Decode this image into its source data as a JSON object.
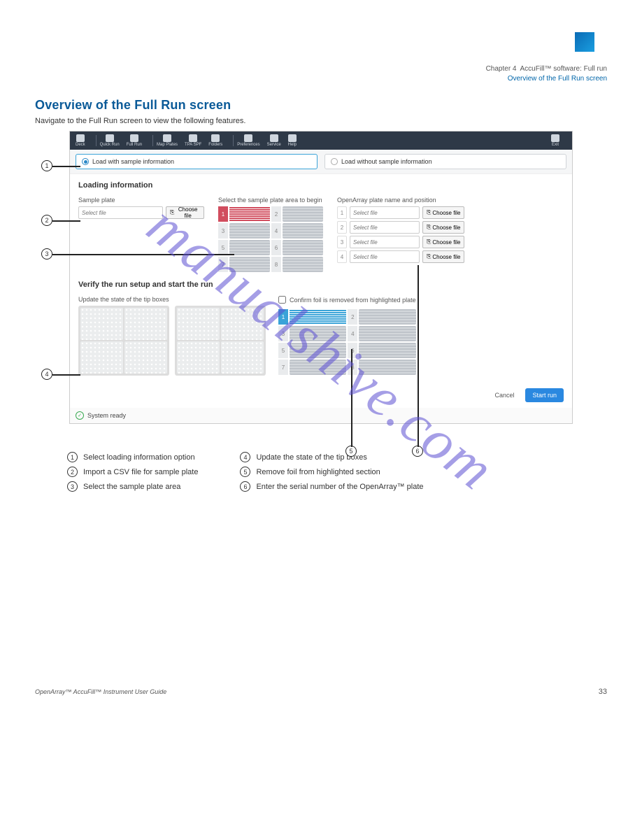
{
  "chapter": {
    "label": "Chapter 4",
    "title": "AccuFill™ software: Full run",
    "subtitle": "Overview of the Full Run screen"
  },
  "page": {
    "heading": "Overview of the Full Run screen",
    "intro": "Navigate to the Full Run screen to view the following features.",
    "watermark": "manualshive.com",
    "footer_left": "OpenArray™ AccuFill™ Instrument User Guide",
    "footer_right": "33"
  },
  "toolbar": {
    "items": [
      "Deck",
      "Quick Run",
      "Full Run",
      "Map Plates",
      "TPA SPF",
      "Folders",
      "Preferences",
      "Service",
      "Help"
    ],
    "exit_label": "Exit"
  },
  "options": {
    "with": "Load with sample information",
    "without": "Load without sample information"
  },
  "loading": {
    "title": "Loading information",
    "sample_label": "Sample plate",
    "sample_placeholder": "Select file",
    "choose_file": "Choose file",
    "area_label": "Select the sample plate area to begin",
    "area_numbers": [
      "1",
      "2",
      "3",
      "4",
      "5",
      "6",
      "7",
      "8"
    ],
    "oa_label": "OpenArray plate name and position",
    "oa_rows": [
      "1",
      "2",
      "3",
      "4"
    ],
    "oa_placeholder": "Select file"
  },
  "verify": {
    "title": "Verify the run setup and start the run",
    "tip_label": "Update the state of the tip boxes",
    "confirm_label": "Confirm foil is removed from highlighted plate"
  },
  "buttons": {
    "cancel": "Cancel",
    "start": "Start run"
  },
  "status": {
    "text": "System ready"
  },
  "callouts": {
    "1": "1",
    "2": "2",
    "3": "3",
    "4": "4",
    "5": "5",
    "6": "6"
  },
  "legend": {
    "1": "Select loading information option",
    "2": "Import a CSV file for sample plate",
    "3": "Select the sample plate area",
    "4": "Update the state of the tip boxes",
    "5": "Remove foil from highlighted section",
    "6": "Enter the serial number of the OpenArray™ plate"
  }
}
